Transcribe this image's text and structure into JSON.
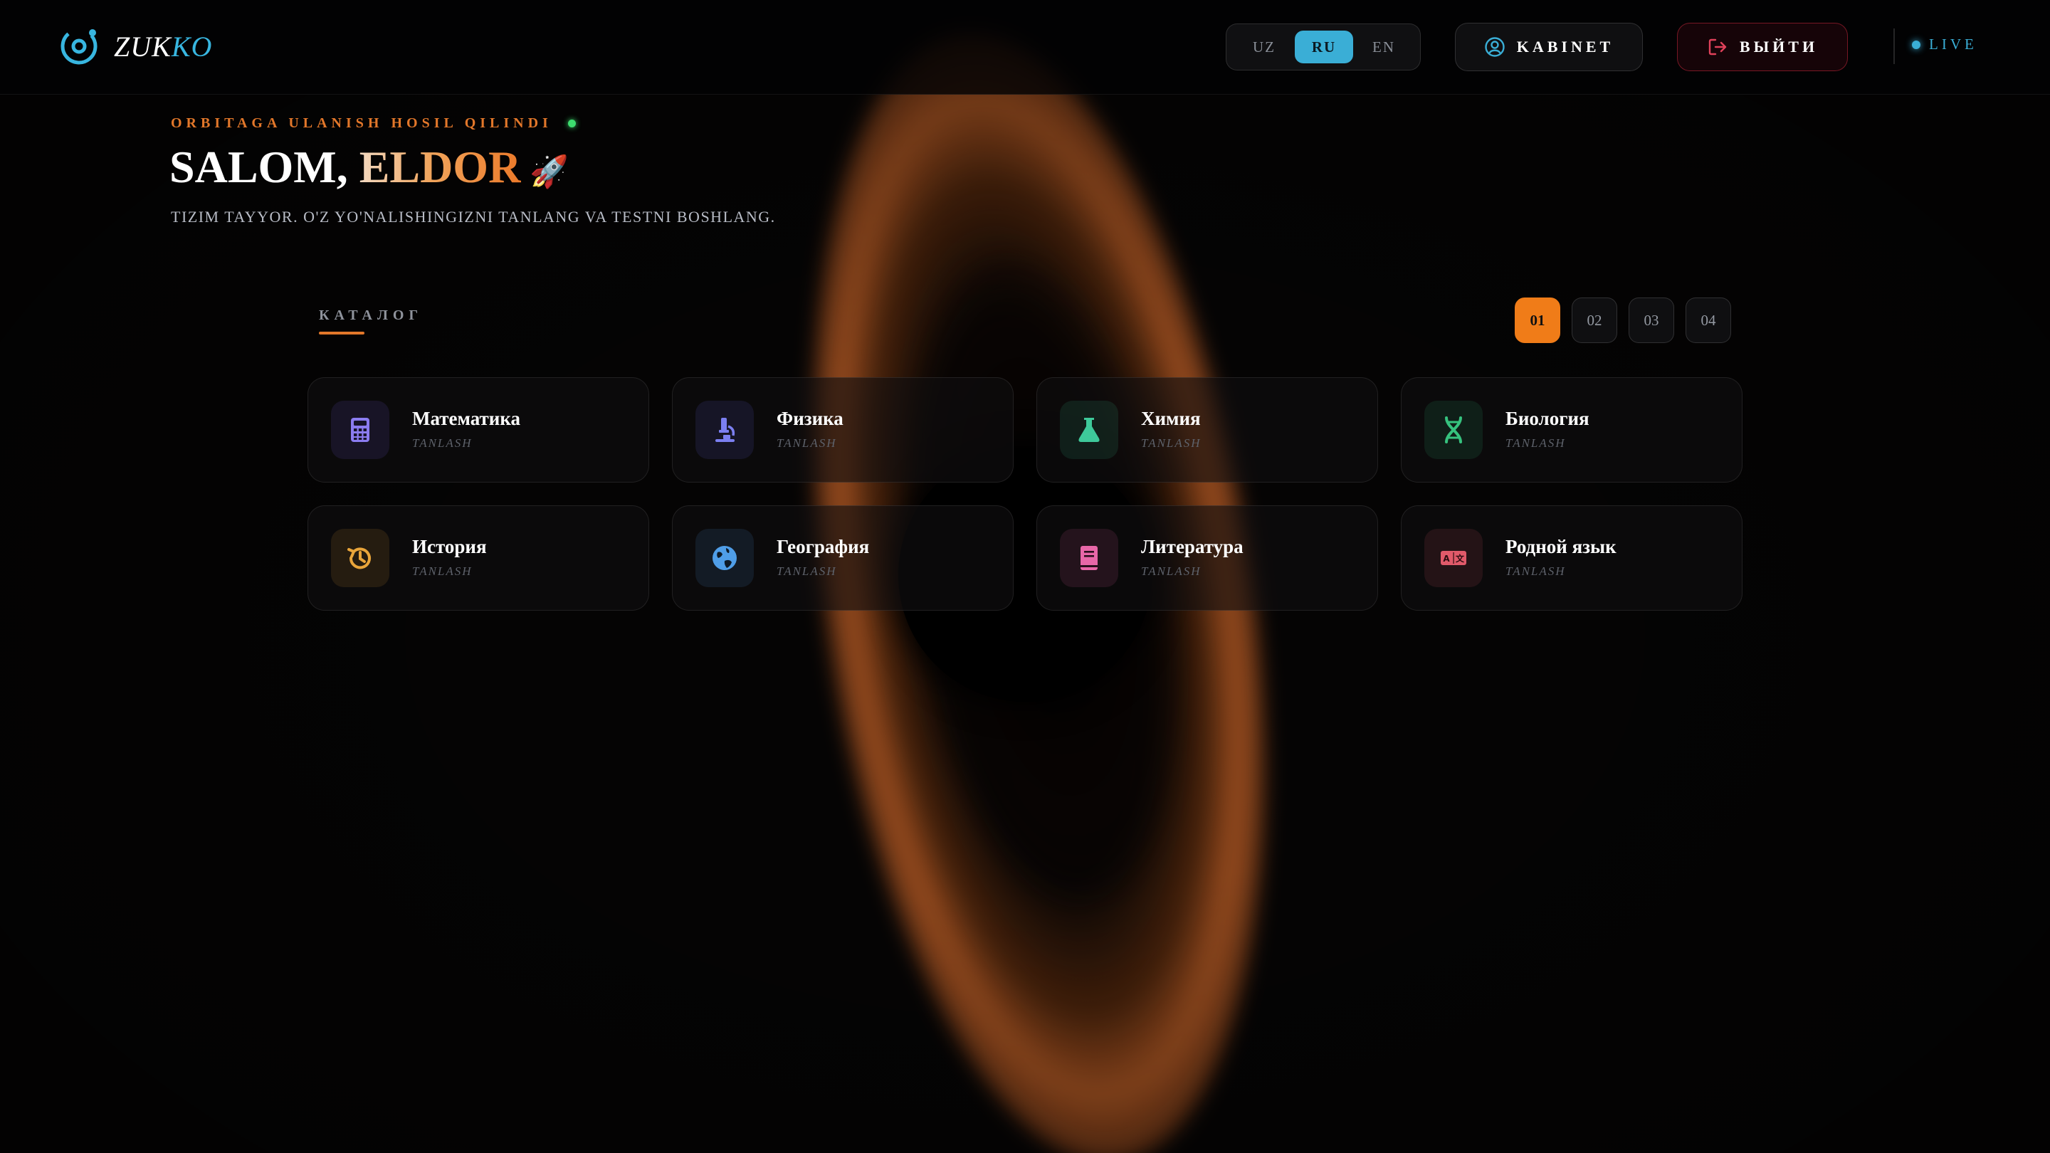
{
  "brand": {
    "name_part1": "ZUK",
    "name_part2": "KO",
    "accent_color": "#38b6e0"
  },
  "header": {
    "languages": [
      {
        "code": "UZ",
        "active": false
      },
      {
        "code": "RU",
        "active": true
      },
      {
        "code": "EN",
        "active": false
      }
    ],
    "cabinet_label": "KABINET",
    "logout_label": "ВЫЙТИ",
    "status_label": "LIVE"
  },
  "hero": {
    "eyebrow": "ORBITAGA ULANISH HOSIL QILINDI",
    "greeting": "SALOM,",
    "name": "ELDOR",
    "emoji": "🚀",
    "subtitle": "TIZIM TAYYOR. O'Z YO'NALISHINGIZNI TANLANG VA TESTNI BOSHLANG."
  },
  "catalog": {
    "label": "КАТАЛОГ",
    "pages": [
      "01",
      "02",
      "03",
      "04"
    ],
    "active_page": "01",
    "subjects": [
      {
        "title": "Математика",
        "action": "TANLASH",
        "icon": "calculator-icon",
        "color": "#8b7cf0"
      },
      {
        "title": "Физика",
        "action": "TANLASH",
        "icon": "microscope-icon",
        "color": "#7b7ff0"
      },
      {
        "title": "Химия",
        "action": "TANLASH",
        "icon": "flask-icon",
        "color": "#3ec99a"
      },
      {
        "title": "Биология",
        "action": "TANLASH",
        "icon": "dna-icon",
        "color": "#36c27e"
      },
      {
        "title": "История",
        "action": "TANLASH",
        "icon": "history-icon",
        "color": "#e9a53a"
      },
      {
        "title": "География",
        "action": "TANLASH",
        "icon": "globe-icon",
        "color": "#4f9ee8"
      },
      {
        "title": "Литература",
        "action": "TANLASH",
        "icon": "book-icon",
        "color": "#e867a8"
      },
      {
        "title": "Родной язык",
        "action": "TANLASH",
        "icon": "translate-icon",
        "color": "#e05a6a"
      }
    ]
  }
}
